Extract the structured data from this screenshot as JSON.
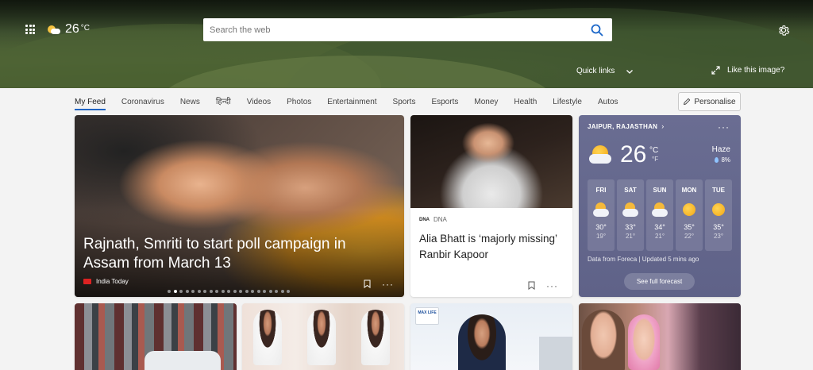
{
  "header": {
    "weather": {
      "temp": "26",
      "unit": "°C"
    },
    "search": {
      "placeholder": "Search the web"
    },
    "quick_links_label": "Quick links",
    "like_image_label": "Like this image?"
  },
  "nav": {
    "items": [
      "My Feed",
      "Coronavirus",
      "News",
      "हिन्दी",
      "Videos",
      "Photos",
      "Entertainment",
      "Sports",
      "Esports",
      "Money",
      "Health",
      "Lifestyle",
      "Autos"
    ],
    "active": "My Feed",
    "personalise_label": "Personalise"
  },
  "hero_card": {
    "title": "Rajnath, Smriti to start poll campaign in Assam from March 13",
    "source": "India Today",
    "carousel_total": 21,
    "carousel_active": 1
  },
  "news_card": {
    "source_logo": "DNA",
    "source": "DNA",
    "title": "Alia Bhatt is ‘majorly missing’ Ranbir Kapoor"
  },
  "weather_card": {
    "location": "JAIPUR, RAJASTHAN",
    "temp": "26",
    "unit_c": "°C",
    "unit_f": "°F",
    "condition": "Haze",
    "humidity": "8%",
    "forecast": [
      {
        "day": "FRI",
        "hi": "30°",
        "lo": "19°",
        "icon": "partly-cloudy-icon"
      },
      {
        "day": "SAT",
        "hi": "33°",
        "lo": "21°",
        "icon": "partly-cloudy-icon"
      },
      {
        "day": "SUN",
        "hi": "34°",
        "lo": "21°",
        "icon": "partly-cloudy-icon"
      },
      {
        "day": "MON",
        "hi": "35°",
        "lo": "22°",
        "icon": "sun-icon"
      },
      {
        "day": "TUE",
        "hi": "35°",
        "lo": "23°",
        "icon": "sun-icon"
      }
    ],
    "footer": "Data from Foreca | Updated 5 mins ago",
    "button_label": "See full forecast"
  },
  "bottom_cards": {
    "insurance_logo": "MAX LIFE"
  },
  "colors": {
    "accent": "#2064c4",
    "weather_card_bg": "#6a6d92"
  }
}
